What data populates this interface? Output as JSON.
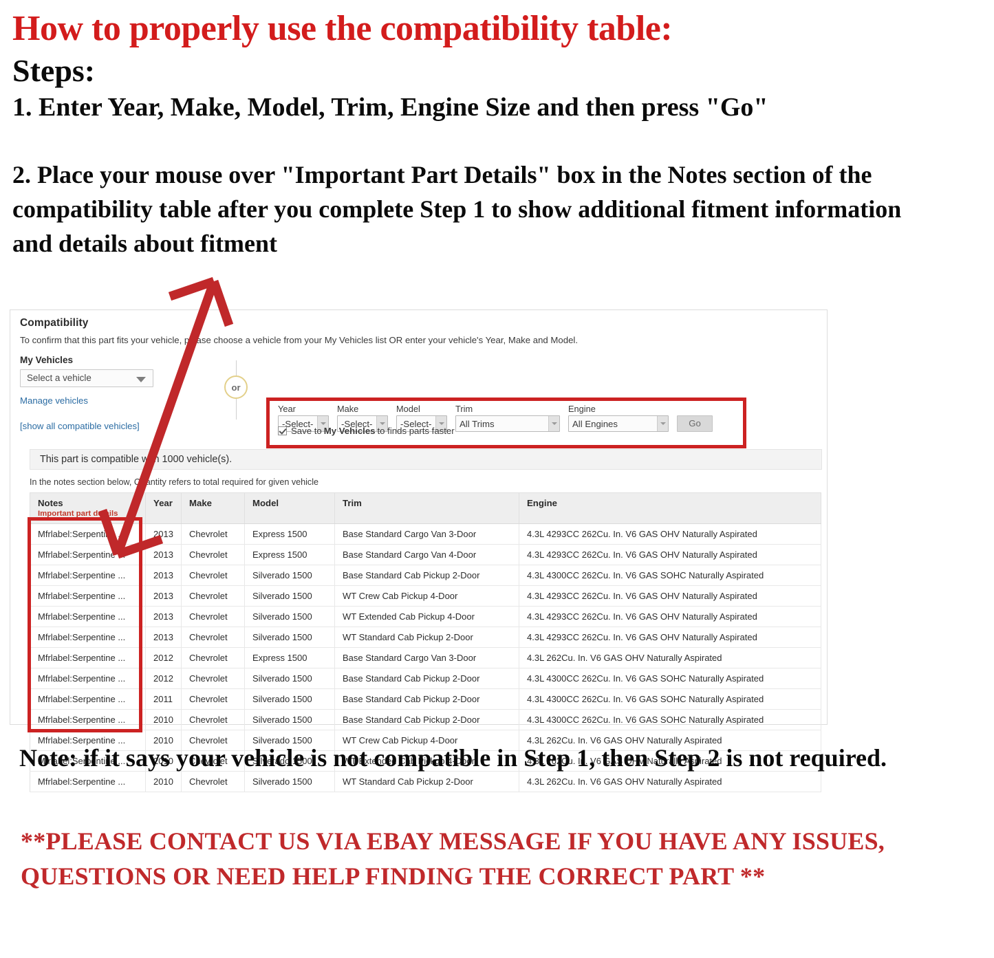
{
  "instructions": {
    "headline": "How to properly use the compatibility table:",
    "steps_label": "Steps:",
    "step_one": "1. Enter Year, Make, Model, Trim, Engine Size and then press \"Go\"",
    "step_two": "2. Place your mouse over \"Important Part Details\" box in the Notes section of the compatibility table after you complete Step 1 to show additional fitment information and details about fitment"
  },
  "compatibility": {
    "title": "Compatibility",
    "subtitle": "To confirm that this part fits your vehicle, please choose a vehicle from your My Vehicles list OR enter your vehicle's Year, Make and Model.",
    "my_vehicles_label": "My Vehicles",
    "my_vehicles_value": "Select a vehicle",
    "manage_vehicles_link": "Manage vehicles",
    "show_all_link": "[show all compatible vehicles]",
    "or_divider": "or",
    "count_text": "This part is compatible with 1000 vehicle(s).",
    "quantity_note": "In the notes section below, Quantity refers to total required for given vehicle",
    "form": {
      "year_label": "Year",
      "year_value": "-Select-",
      "make_label": "Make",
      "make_value": "-Select-",
      "model_label": "Model",
      "model_value": "-Select-",
      "trim_label": "Trim",
      "trim_value": "All Trims",
      "engine_label": "Engine",
      "engine_value": "All Engines",
      "go_label": "Go",
      "save_prefix": "Save to",
      "save_strong": "My Vehicles",
      "save_suffix": "to finds parts faster"
    }
  },
  "table": {
    "headers": {
      "notes": "Notes",
      "notes_sub": "Important part details",
      "year": "Year",
      "make": "Make",
      "model": "Model",
      "trim": "Trim",
      "engine": "Engine"
    },
    "rows": [
      {
        "notes": "Mfrlabel:Serpentine ...",
        "year": "2013",
        "make": "Chevrolet",
        "model": "Express 1500",
        "trim": "Base Standard Cargo Van 3-Door",
        "engine": "4.3L 4293CC 262Cu. In. V6 GAS OHV Naturally Aspirated"
      },
      {
        "notes": "Mfrlabel:Serpentine ...",
        "year": "2013",
        "make": "Chevrolet",
        "model": "Express 1500",
        "trim": "Base Standard Cargo Van 4-Door",
        "engine": "4.3L 4293CC 262Cu. In. V6 GAS OHV Naturally Aspirated"
      },
      {
        "notes": "Mfrlabel:Serpentine ...",
        "year": "2013",
        "make": "Chevrolet",
        "model": "Silverado 1500",
        "trim": "Base Standard Cab Pickup 2-Door",
        "engine": "4.3L 4300CC 262Cu. In. V6 GAS SOHC Naturally Aspirated"
      },
      {
        "notes": "Mfrlabel:Serpentine ...",
        "year": "2013",
        "make": "Chevrolet",
        "model": "Silverado 1500",
        "trim": "WT Crew Cab Pickup 4-Door",
        "engine": "4.3L 4293CC 262Cu. In. V6 GAS OHV Naturally Aspirated"
      },
      {
        "notes": "Mfrlabel:Serpentine ...",
        "year": "2013",
        "make": "Chevrolet",
        "model": "Silverado 1500",
        "trim": "WT Extended Cab Pickup 4-Door",
        "engine": "4.3L 4293CC 262Cu. In. V6 GAS OHV Naturally Aspirated"
      },
      {
        "notes": "Mfrlabel:Serpentine ...",
        "year": "2013",
        "make": "Chevrolet",
        "model": "Silverado 1500",
        "trim": "WT Standard Cab Pickup 2-Door",
        "engine": "4.3L 4293CC 262Cu. In. V6 GAS OHV Naturally Aspirated"
      },
      {
        "notes": "Mfrlabel:Serpentine ...",
        "year": "2012",
        "make": "Chevrolet",
        "model": "Express 1500",
        "trim": "Base Standard Cargo Van 3-Door",
        "engine": "4.3L 262Cu. In. V6 GAS OHV Naturally Aspirated"
      },
      {
        "notes": "Mfrlabel:Serpentine ...",
        "year": "2012",
        "make": "Chevrolet",
        "model": "Silverado 1500",
        "trim": "Base Standard Cab Pickup 2-Door",
        "engine": "4.3L 4300CC 262Cu. In. V6 GAS SOHC Naturally Aspirated"
      },
      {
        "notes": "Mfrlabel:Serpentine ...",
        "year": "2011",
        "make": "Chevrolet",
        "model": "Silverado 1500",
        "trim": "Base Standard Cab Pickup 2-Door",
        "engine": "4.3L 4300CC 262Cu. In. V6 GAS SOHC Naturally Aspirated"
      },
      {
        "notes": "Mfrlabel:Serpentine ...",
        "year": "2010",
        "make": "Chevrolet",
        "model": "Silverado 1500",
        "trim": "Base Standard Cab Pickup 2-Door",
        "engine": "4.3L 4300CC 262Cu. In. V6 GAS SOHC Naturally Aspirated"
      },
      {
        "notes": "Mfrlabel:Serpentine ...",
        "year": "2010",
        "make": "Chevrolet",
        "model": "Silverado 1500",
        "trim": "WT Crew Cab Pickup 4-Door",
        "engine": "4.3L 262Cu. In. V6 GAS OHV Naturally Aspirated"
      },
      {
        "notes": "Mfrlabel:Serpentine ...",
        "year": "2010",
        "make": "Chevrolet",
        "model": "Silverado 1500",
        "trim": "WT Extended Cab Pickup 4-Door",
        "engine": "4.3L 262Cu. In. V6 GAS OHV Naturally Aspirated"
      },
      {
        "notes": "Mfrlabel:Serpentine ...",
        "year": "2010",
        "make": "Chevrolet",
        "model": "Silverado 1500",
        "trim": "WT Standard Cab Pickup 2-Door",
        "engine": "4.3L 262Cu. In. V6 GAS OHV Naturally Aspirated"
      }
    ]
  },
  "footer": {
    "note": "Note: if it says your vehicle is not compatible in Step 1, then Step 2 is not required.",
    "contact": "**PLEASE CONTACT US VIA EBAY MESSAGE IF YOU HAVE ANY ISSUES, QUESTIONS OR NEED HELP FINDING THE CORRECT PART **"
  },
  "colors": {
    "headline_red": "#d31c1c",
    "highlight_red": "#cc2222",
    "link_blue": "#2b6ca3",
    "notes_sub_red": "#c0392b"
  }
}
